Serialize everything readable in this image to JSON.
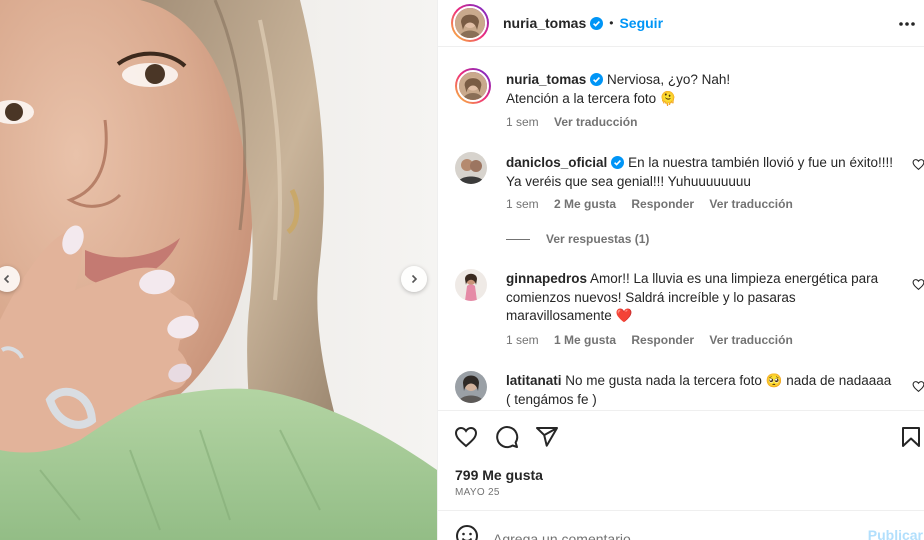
{
  "post": {
    "author": "nuria_tomas",
    "follow_label": "Seguir",
    "separator": "•",
    "caption_line1": "Nerviosa, ¿yo? Nah!",
    "caption_line2": "Atención a la tercera foto 🫠",
    "caption_time": "1 sem",
    "caption_translate": "Ver traducción"
  },
  "comments": [
    {
      "user": "daniclos_oficial",
      "verified": true,
      "text": "En la nuestra también llovió y fue un éxito!!!! Ya veréis que sea genial!!! Yuhuuuuuuuu",
      "time": "1 sem",
      "likes": "2 Me gusta",
      "reply": "Responder",
      "translate": "Ver traducción",
      "replies_label": "Ver respuestas (1)"
    },
    {
      "user": "ginnapedros",
      "verified": false,
      "text": "Amor!! La lluvia es una limpieza energética para comienzos nuevos! Saldrá increíble y lo pasaras maravillosamente ❤️",
      "time": "1 sem",
      "likes": "1 Me gusta",
      "reply": "Responder",
      "translate": "Ver traducción"
    },
    {
      "user": "latitanati",
      "verified": false,
      "text": "No me gusta nada la tercera foto 🥺 nada de nadaaaa ( tengámos fe )"
    }
  ],
  "footer": {
    "likes": "799 Me gusta",
    "date": "MAYO 25",
    "comment_placeholder": "Agrega un comentario...",
    "publish_label": "Publicar"
  },
  "icons": {
    "verified": "verified-badge-icon",
    "more": "more-options-icon",
    "like": "heart-icon",
    "comment": "comment-icon",
    "share": "share-icon",
    "save": "bookmark-icon",
    "emoji": "emoji-icon",
    "prev": "chevron-left-icon",
    "next": "chevron-right-icon"
  },
  "colors": {
    "accent": "#0095f6",
    "publish_disabled": "#b2dffc",
    "secondary_text": "#737373",
    "verified": "#0095f6",
    "heart_emoji": "#e0245e"
  }
}
